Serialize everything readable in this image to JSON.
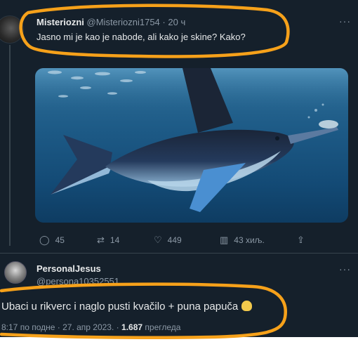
{
  "tweet": {
    "author_name": "Misteriozni",
    "author_handle": "@Misteriozni1754",
    "separator": "·",
    "time_ago": "20 ч",
    "more": "···",
    "text": "Jasno mi je kao je nabode, ali kako je skine? Kako?",
    "image_subject": "marlin-underwater",
    "actions": {
      "replies": "45",
      "retweets": "14",
      "likes": "449",
      "views": "43 хиљ."
    }
  },
  "reply": {
    "author_name": "PersonalJesus",
    "author_handle": "@persona10352551",
    "more": "···",
    "text": "Ubaci u rikverc i naglo pusti kvačilo + puna papuča",
    "emoji": "person-icon",
    "time": "8:17 по подне",
    "date": "27. апр 2023.",
    "views_count": "1.687",
    "views_label": "прегледа"
  },
  "colors": {
    "background": "#15202b",
    "text": "#e7e9ea",
    "muted": "#8b98a5",
    "annotation": "#f6a11a"
  }
}
